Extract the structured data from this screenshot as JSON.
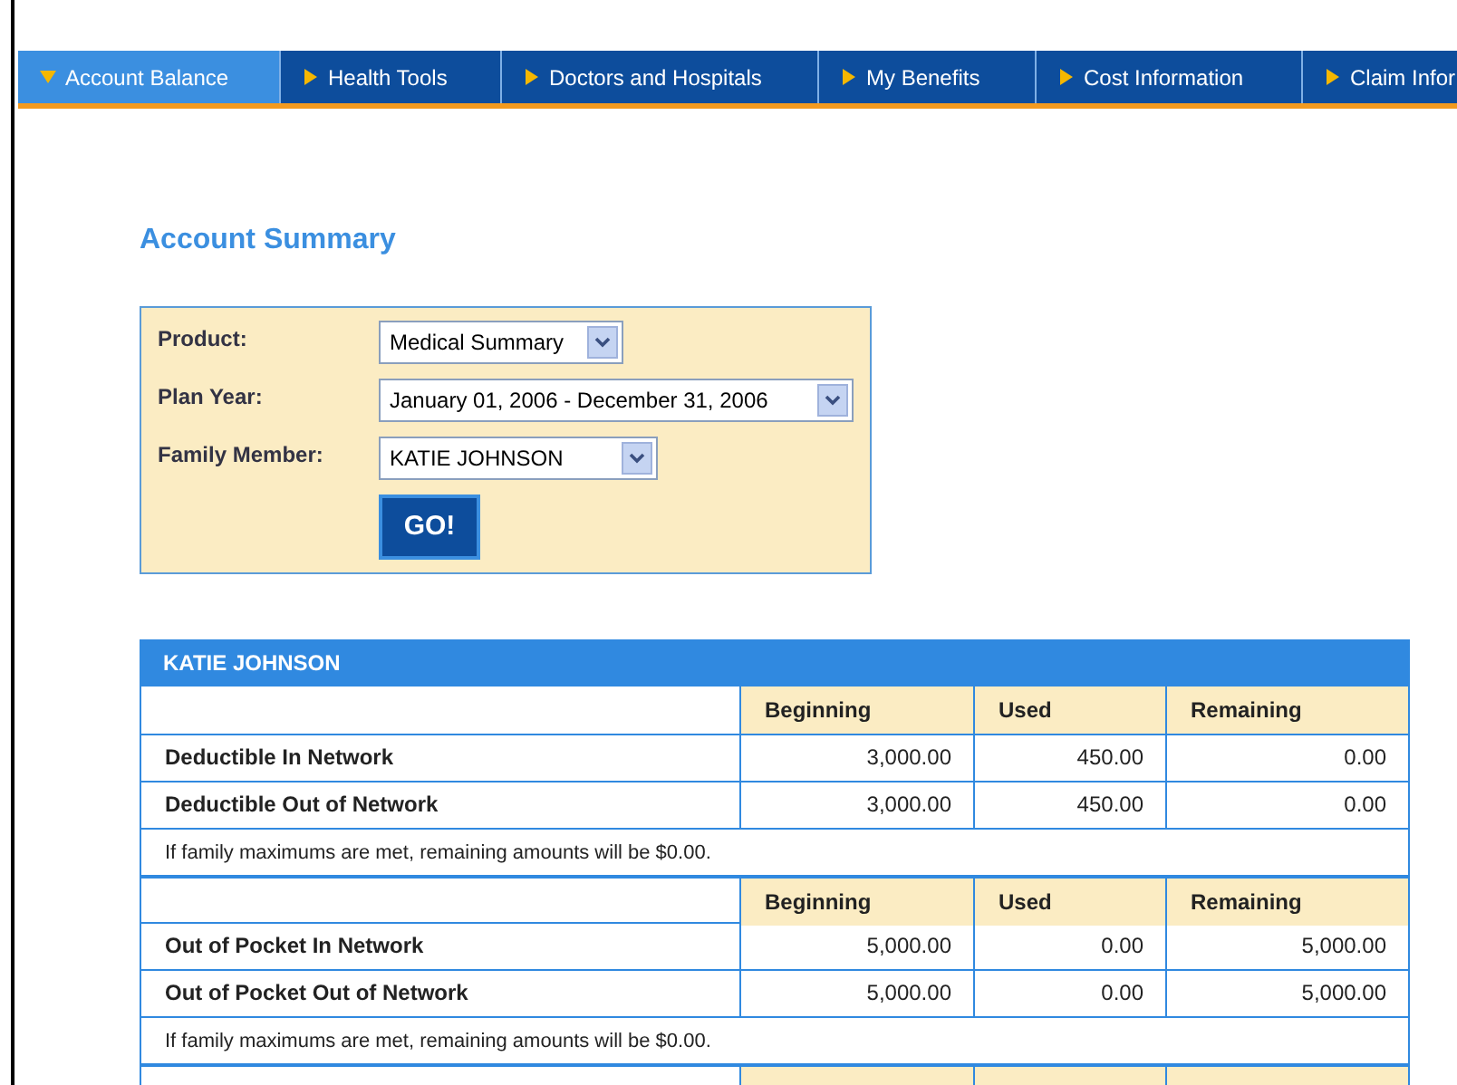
{
  "nav": {
    "tabs": [
      {
        "label": "Account Balance",
        "selected": true
      },
      {
        "label": "Health Tools",
        "selected": false
      },
      {
        "label": "Doctors and Hospitals",
        "selected": false
      },
      {
        "label": "My Benefits",
        "selected": false
      },
      {
        "label": "Cost Information",
        "selected": false
      },
      {
        "label": "Claim Infor",
        "selected": false
      }
    ]
  },
  "title": "Account Summary",
  "filters": [
    {
      "label": "Product:",
      "value": "Medical Summary"
    },
    {
      "label": "Plan Year:",
      "value": "January 01, 2006 - December 31, 2006"
    },
    {
      "label": "Family Member:",
      "value": "KATIE JOHNSON"
    }
  ],
  "go_button": "GO!",
  "summary": {
    "member": "KATIE JOHNSON",
    "sections": [
      {
        "columns": [
          "Beginning",
          "Used",
          "Remaining"
        ],
        "rows": [
          {
            "label": "Deductible In Network",
            "beginning": "3,000.00",
            "used": "450.00",
            "remaining": "0.00"
          },
          {
            "label": "Deductible Out of Network",
            "beginning": "3,000.00",
            "used": "450.00",
            "remaining": "0.00"
          }
        ],
        "note": "If family maximums are met, remaining amounts will be $0.00."
      },
      {
        "columns": [
          "Beginning",
          "Used",
          "Remaining"
        ],
        "rows": [
          {
            "label": "Out of Pocket In Network",
            "beginning": "5,000.00",
            "used": "0.00",
            "remaining": "5,000.00"
          },
          {
            "label": "Out of Pocket Out of Network",
            "beginning": "5,000.00",
            "used": "0.00",
            "remaining": "5,000.00"
          }
        ],
        "note": "If family maximums are met, remaining amounts will be $0.00."
      }
    ]
  }
}
